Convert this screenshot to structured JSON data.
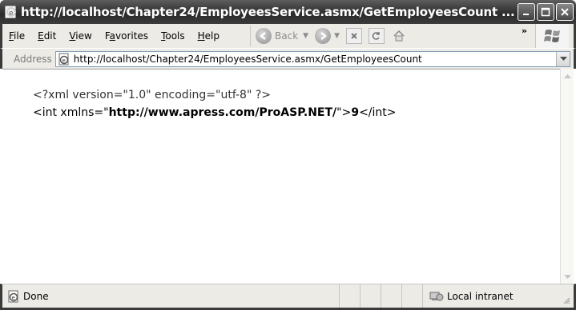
{
  "window": {
    "title": "http://localhost/Chapter24/EmployeesService.asmx/GetEmployeesCount ..."
  },
  "menu": {
    "items": [
      "File",
      "Edit",
      "View",
      "Favorites",
      "Tools",
      "Help"
    ],
    "accelerators": [
      "F",
      "E",
      "V",
      "a",
      "T",
      "H"
    ]
  },
  "toolbar": {
    "back_label": "Back",
    "chevron": "»"
  },
  "address": {
    "label": "Address",
    "url": "http://localhost/Chapter24/EmployeesService.asmx/GetEmployeesCount"
  },
  "content": {
    "xml_declaration": "<?xml version=\"1.0\" encoding=\"utf-8\" ?>",
    "int_open": "<int xmlns=\"",
    "namespace": "http://www.apress.com/ProASP.NET/",
    "quote_close": "\">",
    "value": "9",
    "int_close": "</int>"
  },
  "status": {
    "text": "Done",
    "zone": "Local intranet"
  }
}
